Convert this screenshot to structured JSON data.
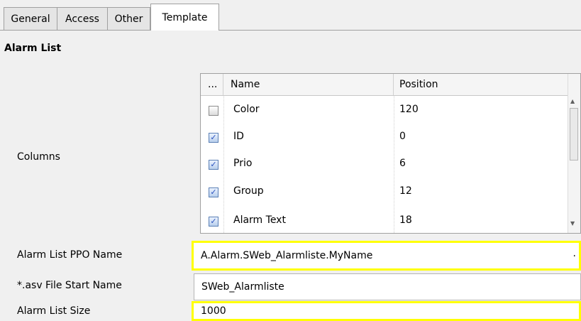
{
  "tabs": [
    {
      "label": "General"
    },
    {
      "label": "Access"
    },
    {
      "label": "Other"
    },
    {
      "label": "Template"
    }
  ],
  "section": {
    "title": "Alarm List"
  },
  "columns": {
    "label": "Columns",
    "header": {
      "more": "...",
      "name": "Name",
      "position": "Position"
    },
    "rows": [
      {
        "name": "Color",
        "position": "120",
        "checked": false
      },
      {
        "name": "ID",
        "position": "0",
        "checked": true
      },
      {
        "name": "Prio",
        "position": "6",
        "checked": true
      },
      {
        "name": "Group",
        "position": "12",
        "checked": true
      },
      {
        "name": "Alarm Text",
        "position": "18",
        "checked": true
      }
    ]
  },
  "fields": {
    "ppo_name": {
      "label": "Alarm List PPO Name",
      "value": "A.Alarm.SWeb_Alarmliste.MyName",
      "browse": "."
    },
    "asv_start": {
      "label": "*.asv File Start Name",
      "value": "SWeb_Alarmliste"
    },
    "size": {
      "label": "Alarm List Size",
      "value": "1000"
    }
  },
  "colors": {
    "highlight": "#ffff00",
    "checkbox_check": "#2a52be"
  }
}
